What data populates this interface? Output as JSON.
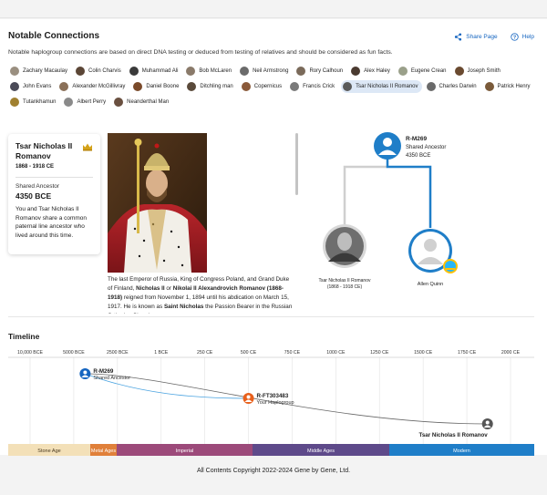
{
  "page": {
    "title": "Notable Connections",
    "subtitle": "Notable haplogroup connections are based on direct DNA testing or deduced from testing of relatives and should be considered as fun facts.",
    "share_label": "Share Page",
    "help_label": "Help",
    "footer": "All Contents Copyright 2022-2024 Gene by Gene, Ltd."
  },
  "chips": [
    {
      "name": "Zachary Macaulay",
      "color": "#9a8f80"
    },
    {
      "name": "Colin Charvis",
      "color": "#5b4636"
    },
    {
      "name": "Muhammad Ali",
      "color": "#3a3a3a"
    },
    {
      "name": "Bob McLaren",
      "color": "#8a7a6a"
    },
    {
      "name": "Neil Armstrong",
      "color": "#6b6b6b"
    },
    {
      "name": "Rory Calhoun",
      "color": "#7a6a5a"
    },
    {
      "name": "Alex Haley",
      "color": "#4a3a30"
    },
    {
      "name": "Eugene Crean",
      "color": "#9aa08a"
    },
    {
      "name": "Joseph Smith",
      "color": "#6a4a30"
    },
    {
      "name": "John Evans",
      "color": "#4a4a58"
    },
    {
      "name": "Alexander McGillivray",
      "color": "#8a7058"
    },
    {
      "name": "Daniel Boone",
      "color": "#7a4a2a"
    },
    {
      "name": "Ditchling man",
      "color": "#5a4a3a"
    },
    {
      "name": "Copernicus",
      "color": "#8a5a3a"
    },
    {
      "name": "Francis Crick",
      "color": "#7a7a7a"
    },
    {
      "name": "Tsar Nicholas II Romanov",
      "color": "#5a5a5a",
      "selected": true
    },
    {
      "name": "Charles Darwin",
      "color": "#6a6a6a"
    },
    {
      "name": "Patrick Henry",
      "color": "#7a5a3a"
    },
    {
      "name": "Tutankhamun",
      "color": "#a08030"
    },
    {
      "name": "Albert Perry",
      "color": "#8a8a8a"
    },
    {
      "name": "Neanderthal Man",
      "color": "#6a5040"
    }
  ],
  "person": {
    "name": "Tsar Nicholas II Romanov",
    "dates": "1868 - 1918 CE",
    "shared_label": "Shared Ancestor",
    "shared_year": "4350 BCE",
    "description": "You and Tsar Nicholas II Romanov share a common paternal line ancestor who lived around this time.",
    "bio_lead": "The last Emperor of Russia, King of Congress Poland, and Grand Duke of Finland, ",
    "bio_name1": "Nicholas II",
    "bio_or": " or ",
    "bio_name2": "Nikolai II Alexandrovich Romanov (1868-1918)",
    "bio_mid": " reigned from November 1, 1894 until his abdication on March 15, 1917. He is known as ",
    "bio_saint": "Saint Nicholas",
    "bio_tail": " the Passion Bearer in the Russian Orthodox Church."
  },
  "tree": {
    "ancestor_haplogroup": "R-M269",
    "ancestor_label": "Shared Ancestor",
    "ancestor_year": "4350 BCE",
    "left_name": "Tsar Nicholas II Romanov",
    "left_dates": "(1868 - 1918 CE)",
    "right_name": "Allen Quinn"
  },
  "timeline": {
    "title": "Timeline",
    "ticks": [
      "10,000 BCE",
      "5000 BCE",
      "2500 BCE",
      "1 BCE",
      "250 CE",
      "500 CE",
      "750 CE",
      "1000 CE",
      "1250 CE",
      "1500 CE",
      "1750 CE",
      "2000 CE"
    ],
    "events": [
      {
        "haplogroup": "R-M269",
        "label": "Shared Ancestor",
        "year": -4350,
        "color": "#1565c0"
      },
      {
        "haplogroup": "R-FT303483",
        "label": "Your Haplogroup",
        "year": 500,
        "color": "#e8601c"
      },
      {
        "haplogroup": "",
        "label": "Tsar Nicholas II Romanov",
        "year": 1868,
        "color": "#555555"
      }
    ],
    "eras": [
      {
        "name": "Stone Age",
        "color": "#f3e0b8"
      },
      {
        "name": "Metal Ages",
        "color": "#e0803a"
      },
      {
        "name": "Imperial",
        "color": "#9c4a7a"
      },
      {
        "name": "Middle Ages",
        "color": "#5e4a8a"
      },
      {
        "name": "Modern",
        "color": "#1f7ec8"
      }
    ]
  }
}
